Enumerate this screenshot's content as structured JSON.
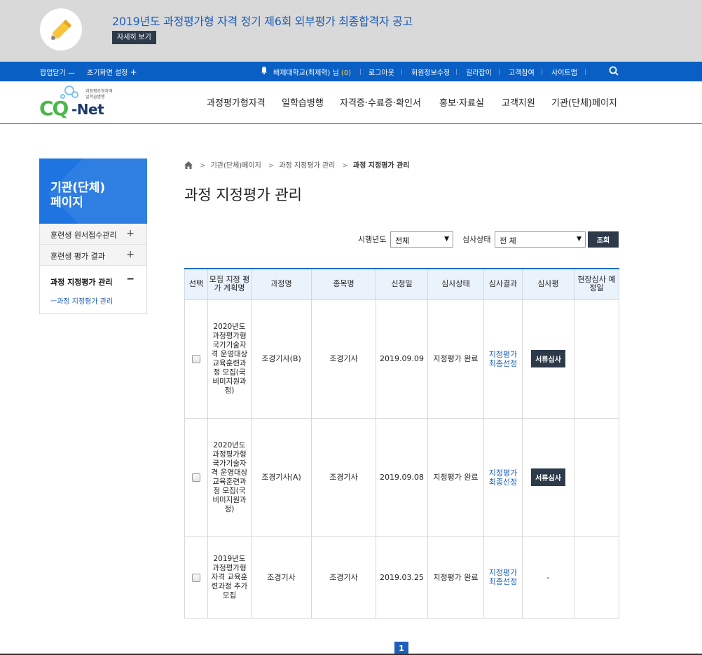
{
  "popup": {
    "title": "2019년도 과정평가형 자격 정기 제6회 외부평가 최종합격자 공고",
    "button": "자세히 보기"
  },
  "topbar": {
    "toggle": "팝업닫기",
    "toggle_sign": "—",
    "home_setting": "초기화면 설정",
    "home_setting_sign": "+",
    "user": "배제대학교(최제혁) 님",
    "count": "(0)",
    "logout": "로그아웃",
    "edit_info": "회원정보수정",
    "guide": "길라잡이",
    "participation": "고객참여",
    "sitemap": "사이트맵"
  },
  "logo": {
    "cq": "CQ",
    "net": "-Net",
    "sub": "과정평가형자격\n일학습병행"
  },
  "gnb": [
    "과정평가형자격",
    "일학습병행",
    "자격증·수료증·확인서",
    "홍보·자료실",
    "고객지원",
    "기관(단체)페이지"
  ],
  "lnb": {
    "title": "기관(단체)\n페이지",
    "items": [
      {
        "label": "훈련생 원서접수관리",
        "sign": "+"
      },
      {
        "label": "훈련생 평가 결과",
        "sign": "+"
      }
    ],
    "active": {
      "label": "과정 지정평가 관리",
      "sign": "−",
      "sub": "ㅡ과정 지정평가 관리"
    }
  },
  "breadcrumb": [
    "기관(단체)페이지",
    "과정 지정평가 관리",
    "과정 지정평가 관리"
  ],
  "page_title": "과정 지정평가 관리",
  "filter": {
    "year_label": "시행년도",
    "year_value": "전체",
    "status_label": "심사상태",
    "status_value": "전 체",
    "search_button": "조회"
  },
  "table": {
    "headers": [
      "선택",
      "모집 지정 평가 계획명",
      "과정명",
      "종목명",
      "신청일",
      "심사상태",
      "심사결과",
      "심사평",
      "현장심사 예정일"
    ],
    "rows": [
      {
        "plan": "2020년도 과정평가형 국가기술자격 운영대상 교육훈련과정 모집(국비미지원과정)",
        "course": "조경기사(B)",
        "item": "조경기사",
        "date": "2019.09.09",
        "status": "지정평가 완료",
        "result": "지정평가 최종선정",
        "review": "서류심사",
        "site_date": ""
      },
      {
        "plan": "2020년도 과정평가형 국가기술자격 운영대상 교육훈련과정 모집(국비미지원과정)",
        "course": "조경기사(A)",
        "item": "조경기사",
        "date": "2019.09.08",
        "status": "지정평가 완료",
        "result": "지정평가 최종선정",
        "review": "서류심사",
        "site_date": ""
      },
      {
        "plan": "2019년도 과정평가형 자격 교육훈련과정 추가 모집",
        "course": "조경기사",
        "item": "조경기사",
        "date": "2019.03.25",
        "status": "지정평가 완료",
        "result": "지정평가 최종선정",
        "review": "-",
        "site_date": ""
      }
    ]
  },
  "pager": {
    "current": "1"
  },
  "icons": {
    "popup": "pencil-icon",
    "bell": "bell-icon",
    "search": "search-icon",
    "home": "home-icon"
  },
  "colors": {
    "primary": "#0a5fc4",
    "dark_button": "#2d3a4a",
    "link": "#1f5fb8"
  }
}
